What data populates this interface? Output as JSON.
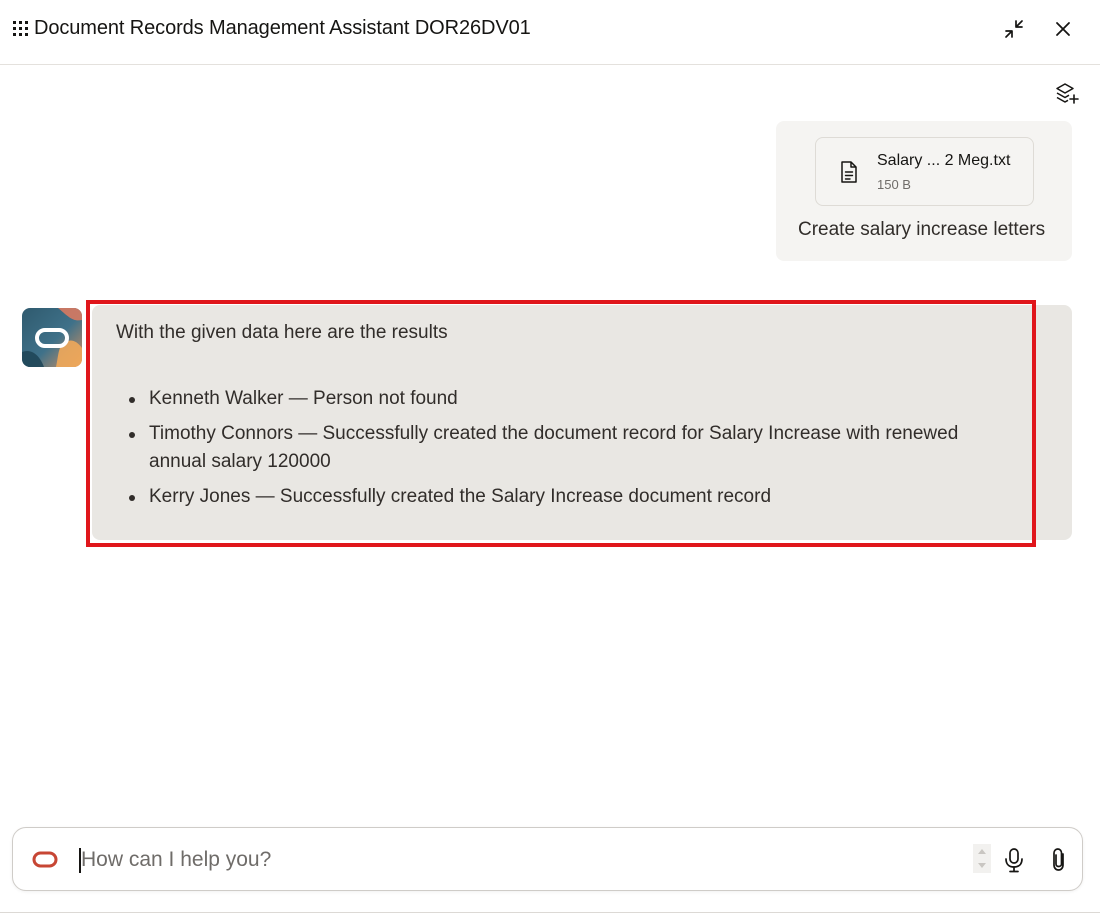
{
  "header": {
    "title": "Document Records Management Assistant DOR26DV01",
    "menu_icon": "grid-dots-icon",
    "minimize_icon": "collapse-icon",
    "close_icon": "close-icon"
  },
  "toolbar": {
    "layers_icon": "layers-plus-icon"
  },
  "user_message": {
    "attachment": {
      "name": "Salary ... 2 Meg.txt",
      "size": "150 B",
      "icon": "document-icon"
    },
    "text": "Create salary increase letters"
  },
  "assistant_message": {
    "intro": "With the given data here are the results",
    "items": [
      "Kenneth Walker — Person not found",
      "Timothy Connors — Successfully created the document record for Salary Increase with renewed annual salary 120000",
      "Kerry Jones — Successfully created the Salary Increase document record"
    ],
    "highlight_color": "#e0161b"
  },
  "composer": {
    "placeholder": "How can I help you?",
    "value": "",
    "logo_icon": "oracle-logo-icon",
    "mic_icon": "microphone-icon",
    "attach_icon": "paperclip-icon"
  },
  "colors": {
    "accent": "#c74634",
    "bubble_bg": "#e9e7e3",
    "user_bubble_bg": "#f5f4f2"
  }
}
